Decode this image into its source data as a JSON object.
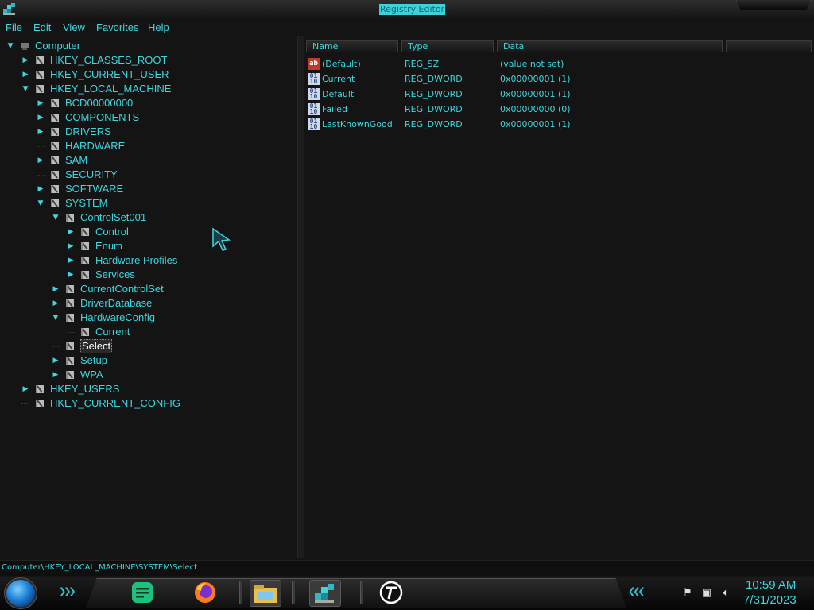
{
  "window": {
    "title": "Registry Editor"
  },
  "menu": {
    "items": [
      "File",
      "Edit",
      "View",
      "Favorites",
      "Help"
    ]
  },
  "tree": {
    "nodes": [
      {
        "label": "Computer",
        "expanded": true
      },
      {
        "label": "HKEY_CLASSES_ROOT",
        "expandable": true
      },
      {
        "label": "HKEY_CURRENT_USER",
        "expandable": true
      },
      {
        "label": "HKEY_LOCAL_MACHINE",
        "expanded": true
      },
      {
        "label": "BCD00000000",
        "expandable": true
      },
      {
        "label": "COMPONENTS",
        "expandable": true
      },
      {
        "label": "DRIVERS",
        "expandable": true
      },
      {
        "label": "HARDWARE",
        "expandable": false
      },
      {
        "label": "SAM",
        "expandable": true
      },
      {
        "label": "SECURITY",
        "expandable": false
      },
      {
        "label": "SOFTWARE",
        "expandable": true
      },
      {
        "label": "SYSTEM",
        "expanded": true
      },
      {
        "label": "ControlSet001",
        "expanded": true
      },
      {
        "label": "Control",
        "expandable": true
      },
      {
        "label": "Enum",
        "expandable": true
      },
      {
        "label": "Hardware Profiles",
        "expandable": true
      },
      {
        "label": "Services",
        "expandable": true
      },
      {
        "label": "CurrentControlSet",
        "expandable": true
      },
      {
        "label": "DriverDatabase",
        "expandable": true
      },
      {
        "label": "HardwareConfig",
        "expanded": true
      },
      {
        "label": "Current",
        "expandable": false
      },
      {
        "label": "Select",
        "selected": true
      },
      {
        "label": "Setup",
        "expandable": true
      },
      {
        "label": "WPA",
        "expandable": true
      },
      {
        "label": "HKEY_USERS",
        "expandable": true
      },
      {
        "label": "HKEY_CURRENT_CONFIG",
        "expandable": false
      }
    ]
  },
  "values": {
    "headers": {
      "name": "Name",
      "type": "Type",
      "data": "Data"
    },
    "rows": [
      {
        "icon": "string-value-icon",
        "name": "(Default)",
        "type": "REG_SZ",
        "data": "(value not set)"
      },
      {
        "icon": "binary-value-icon",
        "name": "Current",
        "type": "REG_DWORD",
        "data": "0x00000001 (1)"
      },
      {
        "icon": "binary-value-icon",
        "name": "Default",
        "type": "REG_DWORD",
        "data": "0x00000001 (1)"
      },
      {
        "icon": "binary-value-icon",
        "name": "Failed",
        "type": "REG_DWORD",
        "data": "0x00000000 (0)"
      },
      {
        "icon": "binary-value-icon",
        "name": "LastKnownGood",
        "type": "REG_DWORD",
        "data": "0x00000001 (1)"
      }
    ]
  },
  "status": {
    "path": "Computer\\HKEY_LOCAL_MACHINE\\SYSTEM\\Select"
  },
  "taskbar": {
    "apps": [
      "notes-app-icon",
      "firefox-icon",
      "file-explorer-icon",
      "registry-editor-icon",
      "typora-icon"
    ],
    "clock_time": "10:59 AM",
    "clock_date": "7/31/2023"
  },
  "colors": {
    "accent": "#3ed6df",
    "background": "#141414",
    "selected_text": "#ffffff"
  }
}
